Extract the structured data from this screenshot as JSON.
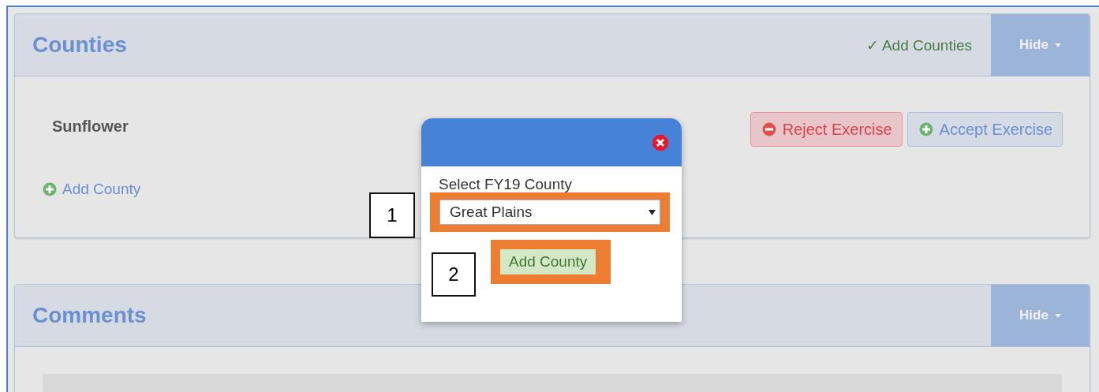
{
  "panels": [
    {
      "kind": "counties",
      "title": "Counties",
      "status": "✓ Add Counties",
      "hide_label": "Hide",
      "county": "Sunflower",
      "add_link": "Add County",
      "buttons": [
        {
          "kind": "reject",
          "label": "Reject Exercise"
        },
        {
          "kind": "accept",
          "label": "Accept Exercise"
        }
      ]
    },
    {
      "kind": "comments",
      "title": "Comments",
      "hide_label": "Hide"
    }
  ],
  "modal": {
    "label": "Select FY19 County",
    "select_value": "Great Plains",
    "button": "Add County"
  },
  "callouts": [
    {
      "label": "1"
    },
    {
      "label": "2"
    }
  ]
}
